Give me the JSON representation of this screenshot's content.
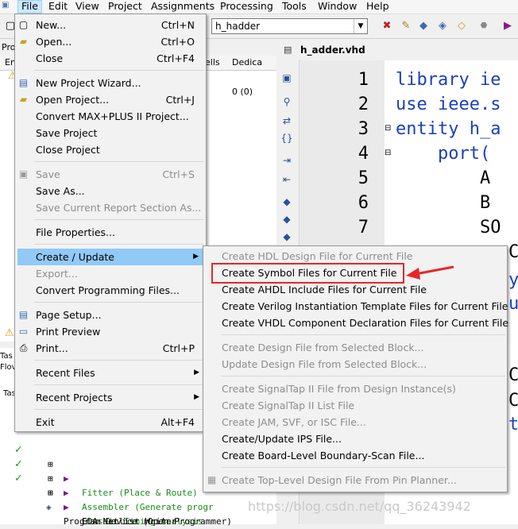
{
  "menubar": {
    "items": [
      "File",
      "Edit",
      "View",
      "Project",
      "Assignments",
      "Processing",
      "Tools",
      "Window",
      "Help"
    ]
  },
  "toolbar": {
    "entity_combo": "h_hadder",
    "icons": [
      "chip-x-icon",
      "pencil-icon",
      "compile-icon",
      "check-icon",
      "settings-icon",
      "stop-icon",
      "play-icon"
    ]
  },
  "editor": {
    "tab_label": "h_adder.vhd",
    "line_numbers": [
      "1",
      "2",
      "3",
      "4",
      "5",
      "6",
      "7"
    ],
    "lines": [
      "library ie",
      "use ieee.s",
      "entity h_a",
      "    port(",
      "        A",
      "        B",
      "        SO"
    ],
    "extra_fragments": [
      "C",
      "y",
      "u",
      "C",
      "C",
      "t"
    ]
  },
  "left_panel": {
    "top_header_fragments": [
      "Proj",
      "En",
      "ells",
      "Dedica"
    ],
    "dedicated_value": "0 (0)",
    "bottom_header_fragments": [
      "Tas",
      "Flov",
      "Tas"
    ],
    "tasks": [
      {
        "done": true,
        "label": "Fitter (Place & Route)"
      },
      {
        "done": true,
        "label": "Assembler (Generate progr"
      },
      {
        "done": true,
        "label": "Classic Timing Analysis"
      },
      {
        "done": false,
        "label": "EDA Netlist Writer"
      },
      {
        "done": false,
        "label": "Program Device (Open Programmer)"
      }
    ]
  },
  "file_menu": {
    "items": [
      {
        "label": "New...",
        "shortcut": "Ctrl+N",
        "icon": "new-file-icon",
        "enabled": true
      },
      {
        "label": "Open...",
        "shortcut": "Ctrl+O",
        "icon": "open-folder-icon",
        "enabled": true
      },
      {
        "label": "Close",
        "shortcut": "Ctrl+F4",
        "enabled": true
      },
      {
        "label": "New Project Wizard...",
        "icon": "wizard-icon",
        "enabled": true
      },
      {
        "label": "Open Project...",
        "shortcut": "Ctrl+J",
        "icon": "open-project-icon",
        "enabled": true
      },
      {
        "label": "Convert MAX+PLUS II Project...",
        "enabled": true
      },
      {
        "label": "Save Project",
        "enabled": true
      },
      {
        "label": "Close Project",
        "enabled": true
      },
      {
        "label": "Save",
        "shortcut": "Ctrl+S",
        "icon": "save-icon",
        "enabled": false
      },
      {
        "label": "Save As...",
        "enabled": true
      },
      {
        "label": "Save Current Report Section As...",
        "enabled": false
      },
      {
        "label": "File Properties...",
        "enabled": true
      },
      {
        "label": "Create / Update",
        "submenu": true,
        "enabled": true
      },
      {
        "label": "Export...",
        "enabled": false
      },
      {
        "label": "Convert Programming Files...",
        "enabled": true
      },
      {
        "label": "Page Setup...",
        "icon": "page-setup-icon",
        "enabled": true
      },
      {
        "label": "Print Preview",
        "icon": "print-preview-icon",
        "enabled": true
      },
      {
        "label": "Print...",
        "shortcut": "Ctrl+P",
        "icon": "printer-icon",
        "enabled": true
      },
      {
        "label": "Recent Files",
        "submenu": true,
        "enabled": true
      },
      {
        "label": "Recent Projects",
        "submenu": true,
        "enabled": true
      },
      {
        "label": "Exit",
        "shortcut": "Alt+F4",
        "enabled": true
      }
    ]
  },
  "submenu": {
    "items": [
      {
        "label": "Create HDL Design File for Current File",
        "enabled": false
      },
      {
        "label": "Create Symbol Files for Current File",
        "enabled": true
      },
      {
        "label": "Create AHDL Include Files for Current File",
        "enabled": true
      },
      {
        "label": "Create Verilog Instantiation Template Files for Current File",
        "enabled": true
      },
      {
        "label": "Create VHDL Component Declaration Files for Current File",
        "enabled": true
      },
      {
        "label": "Create Design File from Selected Block...",
        "enabled": false
      },
      {
        "label": "Update Design File from Selected Block...",
        "enabled": false
      },
      {
        "label": "Create SignalTap II File from Design Instance(s)",
        "enabled": false
      },
      {
        "label": "Create SignalTap II List File",
        "enabled": false
      },
      {
        "label": "Create JAM, SVF, or ISC File...",
        "enabled": false
      },
      {
        "label": "Create/Update IPS File...",
        "enabled": true
      },
      {
        "label": "Create Board-Level Boundary-Scan File...",
        "enabled": true
      },
      {
        "label": "Create Top-Level Design File From Pin Planner...",
        "icon": "pin-planner-icon",
        "enabled": false
      }
    ]
  },
  "watermark": "https://blog.csdn.net/qq_36243942",
  "colors": {
    "highlight": "#91c9f7",
    "annotation_red": "#e8262a",
    "keyword_blue": "#1c3fbf",
    "check_green": "#18a018"
  }
}
